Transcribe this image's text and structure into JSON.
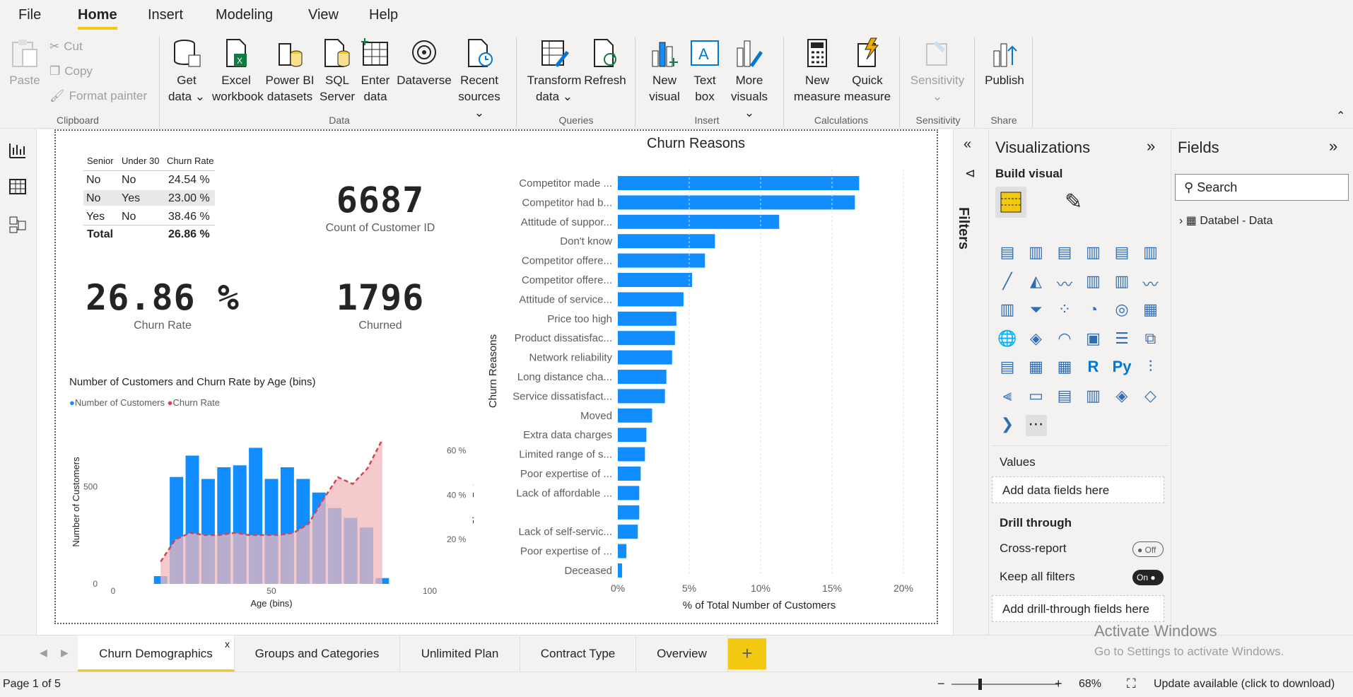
{
  "menu": {
    "items": [
      "File",
      "Home",
      "Insert",
      "Modeling",
      "View",
      "Help"
    ],
    "active": "Home"
  },
  "ribbon": {
    "clipboard": {
      "paste": "Paste",
      "cut": "Cut",
      "copy": "Copy",
      "format_painter": "Format painter",
      "group": "Clipboard"
    },
    "data": {
      "get_data": [
        "Get",
        "data"
      ],
      "excel": [
        "Excel",
        "workbook"
      ],
      "powerbi": [
        "Power BI",
        "datasets"
      ],
      "sql": [
        "SQL",
        "Server"
      ],
      "enter": [
        "Enter",
        "data"
      ],
      "dataverse": "Dataverse",
      "recent": [
        "Recent",
        "sources"
      ],
      "group": "Data"
    },
    "queries": {
      "transform": [
        "Transform",
        "data"
      ],
      "refresh": "Refresh",
      "group": "Queries"
    },
    "insert": {
      "new_visual": [
        "New",
        "visual"
      ],
      "text_box": [
        "Text",
        "box"
      ],
      "more_visuals": [
        "More",
        "visuals"
      ],
      "group": "Insert"
    },
    "calculations": {
      "new_measure": [
        "New",
        "measure"
      ],
      "quick_measure": [
        "Quick",
        "measure"
      ],
      "group": "Calculations"
    },
    "sensitivity": {
      "label": "Sensitivity",
      "group": "Sensitivity"
    },
    "share": {
      "publish": "Publish",
      "group": "Share"
    }
  },
  "matrix": {
    "headers": [
      "Senior",
      "Under 30",
      "Churn Rate"
    ],
    "rows": [
      [
        "No",
        "No",
        "24.54 %"
      ],
      [
        "No",
        "Yes",
        "23.00 %"
      ],
      [
        "Yes",
        "No",
        "38.46 %"
      ]
    ],
    "total": [
      "Total",
      "",
      "26.86 %"
    ]
  },
  "kpis": {
    "count": {
      "value": "6687",
      "label": "Count of Customer ID"
    },
    "churn_rate": {
      "value": "26.86 %",
      "label": "Churn Rate"
    },
    "churned": {
      "value": "1796",
      "label": "Churned"
    }
  },
  "age_chart": {
    "title": "Number of Customers and Churn Rate by Age (bins)",
    "legend": [
      "Number of Customers",
      "Churn Rate"
    ],
    "xlabel": "Age (bins)",
    "ylabel_left": "Number of Customers",
    "ylabel_right": "Churn Rate",
    "x_ticks": [
      "0",
      "50",
      "100"
    ],
    "y_left_ticks": [
      "0",
      "500"
    ],
    "y_right_ticks": [
      "20 %",
      "40 %",
      "60 %"
    ]
  },
  "churn_chart": {
    "title": "Churn Reasons",
    "ylabel": "Churn Reasons",
    "xlabel": "% of Total Number of Customers",
    "x_ticks": [
      "0%",
      "5%",
      "10%",
      "15%",
      "20%"
    ]
  },
  "chart_data": [
    {
      "type": "bar",
      "title": "Churn Reasons",
      "xlabel": "% of Total Number of Customers",
      "ylabel": "Churn Reasons",
      "orientation": "horizontal",
      "xlim": [
        0,
        20
      ],
      "categories": [
        "Competitor made ...",
        "Competitor had b...",
        "Attitude of suppor...",
        "Don't know",
        "Competitor offere...",
        "Competitor offere...",
        "Attitude of service...",
        "Price too high",
        "Product dissatisfac...",
        "Network reliability",
        "Long distance cha...",
        "Service dissatisfact...",
        "Moved",
        "Extra data charges",
        "Limited range of s...",
        "Poor expertise of ...",
        "Lack of affordable ...",
        "",
        "Lack of self-servic...",
        "Poor expertise of ...",
        "Deceased"
      ],
      "values": [
        16.9,
        16.6,
        11.3,
        6.8,
        6.1,
        5.2,
        4.6,
        4.1,
        4.0,
        3.8,
        3.4,
        3.3,
        2.4,
        2.0,
        1.9,
        1.6,
        1.5,
        1.5,
        1.4,
        0.6,
        0.3
      ]
    },
    {
      "type": "bar",
      "title": "Number of Customers and Churn Rate by Age (bins)",
      "xlabel": "Age (bins)",
      "ylabel": "Number of Customers",
      "xlim": [
        0,
        100
      ],
      "ylim": [
        0,
        800
      ],
      "x": [
        15,
        20,
        25,
        30,
        35,
        40,
        45,
        50,
        55,
        60,
        65,
        70,
        75,
        80,
        85
      ],
      "series": [
        {
          "name": "Number of Customers",
          "values": [
            40,
            550,
            660,
            540,
            600,
            610,
            700,
            540,
            600,
            540,
            470,
            390,
            340,
            290,
            30
          ]
        },
        {
          "name": "Churn Rate",
          "values_percent": [
            10,
            20,
            23,
            22,
            22,
            23,
            22,
            22,
            22,
            23,
            27,
            38,
            48,
            45,
            52,
            65
          ]
        }
      ]
    }
  ],
  "filters": {
    "label": "Filters"
  },
  "viz": {
    "title": "Visualizations",
    "build": "Build visual",
    "values": "Values",
    "values_well": "Add data fields here",
    "drill": "Drill through",
    "cross_report": "Cross-report",
    "cross_state": "Off",
    "keep_filters": "Keep all filters",
    "keep_state": "On",
    "drill_well": "Add drill-through fields here"
  },
  "fields": {
    "title": "Fields",
    "search_placeholder": "Search",
    "table": "Databel - Data"
  },
  "tabs": [
    "Churn Demographics",
    "Groups and Categories",
    "Unlimited Plan",
    "Contract Type",
    "Overview"
  ],
  "tab_close": "x",
  "status": {
    "page": "Page 1 of 5",
    "zoom": "68%",
    "update": "Update available (click to download)"
  },
  "watermark": {
    "line1": "Activate Windows",
    "line2": "Go to Settings to activate Windows."
  },
  "colors": {
    "accent": "#f2c811",
    "bar": "#118dff",
    "churn_line": "#d64550",
    "churn_area": "#f0b8bc"
  }
}
